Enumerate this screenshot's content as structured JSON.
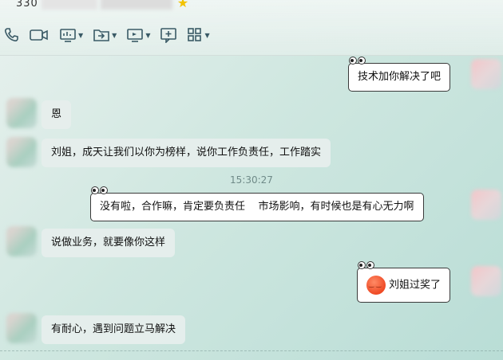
{
  "header": {
    "contact_name": "330",
    "toolbar": [
      {
        "icon": "phone-icon"
      },
      {
        "icon": "video-icon"
      },
      {
        "icon": "screen-share-icon",
        "has_dropdown": true
      },
      {
        "icon": "file-transfer-icon",
        "has_dropdown": true
      },
      {
        "icon": "remote-desktop-icon",
        "has_dropdown": true
      },
      {
        "icon": "add-chat-icon"
      },
      {
        "icon": "apps-grid-icon",
        "has_dropdown": true
      }
    ]
  },
  "messages": [
    {
      "side": "right",
      "text": "技术加你解决了吧"
    },
    {
      "side": "left",
      "text": "恩"
    },
    {
      "side": "left",
      "text": "刘姐，成天让我们以你为榜样，说你工作负责任，工作踏实"
    },
    {
      "side": "right",
      "text": "没有啦，合作嘛，肯定要负责任    市场影响，有时候也是有心无力啊"
    },
    {
      "side": "left",
      "text": "说做业务，就要像你这样"
    },
    {
      "side": "right",
      "text": "刘姐过奖了",
      "emoji": "smile-emoji"
    },
    {
      "side": "left",
      "text": "有耐心，遇到问题立马解决"
    }
  ],
  "timestamp": "15:30:27",
  "colors": {
    "icon": "#3a5a66",
    "bubble_border": "#3a3a3a",
    "emoji": "#ef4a25"
  }
}
